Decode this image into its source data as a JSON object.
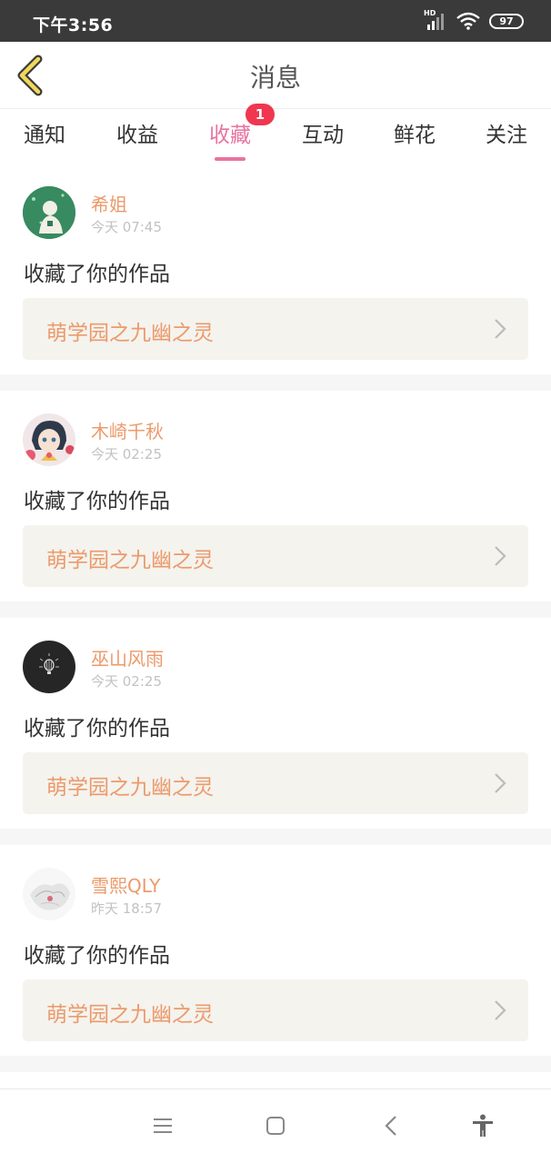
{
  "status_bar": {
    "time": "下午3:56",
    "network": "HD",
    "battery": "97"
  },
  "header": {
    "title": "消息"
  },
  "tabs": [
    {
      "label": "通知",
      "active": false
    },
    {
      "label": "收益",
      "active": false
    },
    {
      "label": "收藏",
      "active": true,
      "badge": "1"
    },
    {
      "label": "互动",
      "active": false
    },
    {
      "label": "鲜花",
      "active": false
    },
    {
      "label": "关注",
      "active": false
    }
  ],
  "messages": [
    {
      "username": "希姐",
      "time": "今天 07:45",
      "action": "收藏了你的作品",
      "work_title": "萌学园之九幽之灵",
      "avatar": "green-photo"
    },
    {
      "username": "木崎千秋",
      "time": "今天 02:25",
      "action": "收藏了你的作品",
      "work_title": "萌学园之九幽之灵",
      "avatar": "anime-girl"
    },
    {
      "username": "巫山风雨",
      "time": "今天 02:25",
      "action": "收藏了你的作品",
      "work_title": "萌学园之九幽之灵",
      "avatar": "dark-balloon"
    },
    {
      "username": "雪熙QLY",
      "time": "昨天 18:57",
      "action": "收藏了你的作品",
      "work_title": "萌学园之九幽之灵",
      "avatar": "white-sketch"
    }
  ],
  "colors": {
    "accent": "#e8739f",
    "name": "#ec9a6b",
    "badge": "#f0374f",
    "card_bg": "#f4f3ee"
  }
}
